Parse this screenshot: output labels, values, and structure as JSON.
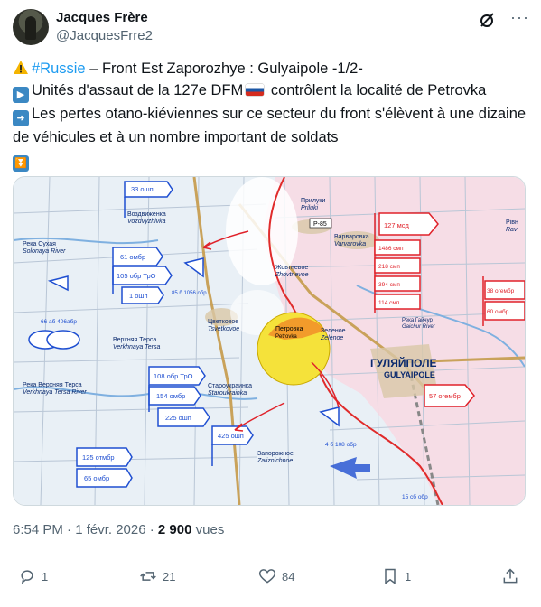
{
  "author": {
    "name": "Jacques Frère",
    "handle": "@JacquesFrre2"
  },
  "icons": {
    "grok": "grok-icon",
    "more": "more-dots-icon",
    "reply": "reply-icon",
    "retweet": "retweet-icon",
    "like": "heart-icon",
    "bookmark": "bookmark-icon",
    "share": "share-icon"
  },
  "tweet": {
    "line1_hashtag": "#Russie",
    "line1_rest": " – Front Est Zaporozhye : Gulyaipole -1/2-",
    "line2_a": "Unités d'assaut de la 127e DFM",
    "line2_b": " contrôlent la localité de Petrovka",
    "line3": "Les pertes otano-kiéviennes sur ce secteur du front s'élèvent à une dizaine de véhicules et à un nombre important de soldats"
  },
  "map": {
    "labels": {
      "voz1": "33 ошп",
      "voz2": "Воздвиженка",
      "voz3": "Vozdvyzhivka",
      "river1": "Река Сухая",
      "river2": "Solonaya River",
      "u61": "61 омбр",
      "u105": "105 обр ТрО",
      "u1": "1 ошп",
      "u66": "66 аб 406абр",
      "terse1": "Верхняя Терса",
      "terse2": "Verkhnaya Tersa",
      "u108": "108 обр ТрО",
      "u154": "154 омбр",
      "u225": "225 ошп",
      "u425": "425 ошп",
      "u125": "125 отмбр",
      "u65": "65 омбр",
      "rivT1": "Река Верхняя Терса",
      "rivT2": "Verkhnaya Tersa River",
      "zhov1": "Жовтневое",
      "zhov2": "Zhovtnevoe",
      "cvet1": "Цветковое",
      "cvet2": "Tsvetkovoe",
      "pril1": "Прилуки",
      "pril2": "Priluki",
      "var1": "Варваровка",
      "var2": "Varvarovka",
      "p85": "P-85",
      "petr1": "Петровка",
      "petr2": "Petrovka",
      "star1": "Староукраинка",
      "star2": "Staroukrainka",
      "zel1": "Зеленое",
      "zel2": "Zelenoe",
      "zap1": "Запорожное",
      "zap2": "Zaliznichnoe",
      "gul1": "ГУЛЯЙПОЛЕ",
      "gul2": "GULYAIPOLE",
      "u127": "127 мсд",
      "u1486": "1486 смп",
      "u218": "218 смп",
      "u394": "394 смп",
      "u114": "114 смп",
      "u38": "38 огембр",
      "u60": "60 омбр",
      "u57": "57 огембр",
      "u4": "4 б 108 обр",
      "u15": "15 сб обр",
      "rav1": "Рівн",
      "rav2": "Rav",
      "u85": "85 б 1056 обр",
      "rivG1": "Река Гайчур",
      "rivG2": "Gaichur River"
    }
  },
  "meta": {
    "time": "6:54 PM · 1 févr. 2026 · ",
    "views": "2 900",
    "views_label": " vues"
  },
  "stats": {
    "replies": "1",
    "retweets": "21",
    "likes": "84",
    "bookmarks": "1"
  },
  "colors": {
    "accent": "#1d9bf0",
    "ukraine_units": "#1f4fd1",
    "russian_units": "#e0222a"
  }
}
